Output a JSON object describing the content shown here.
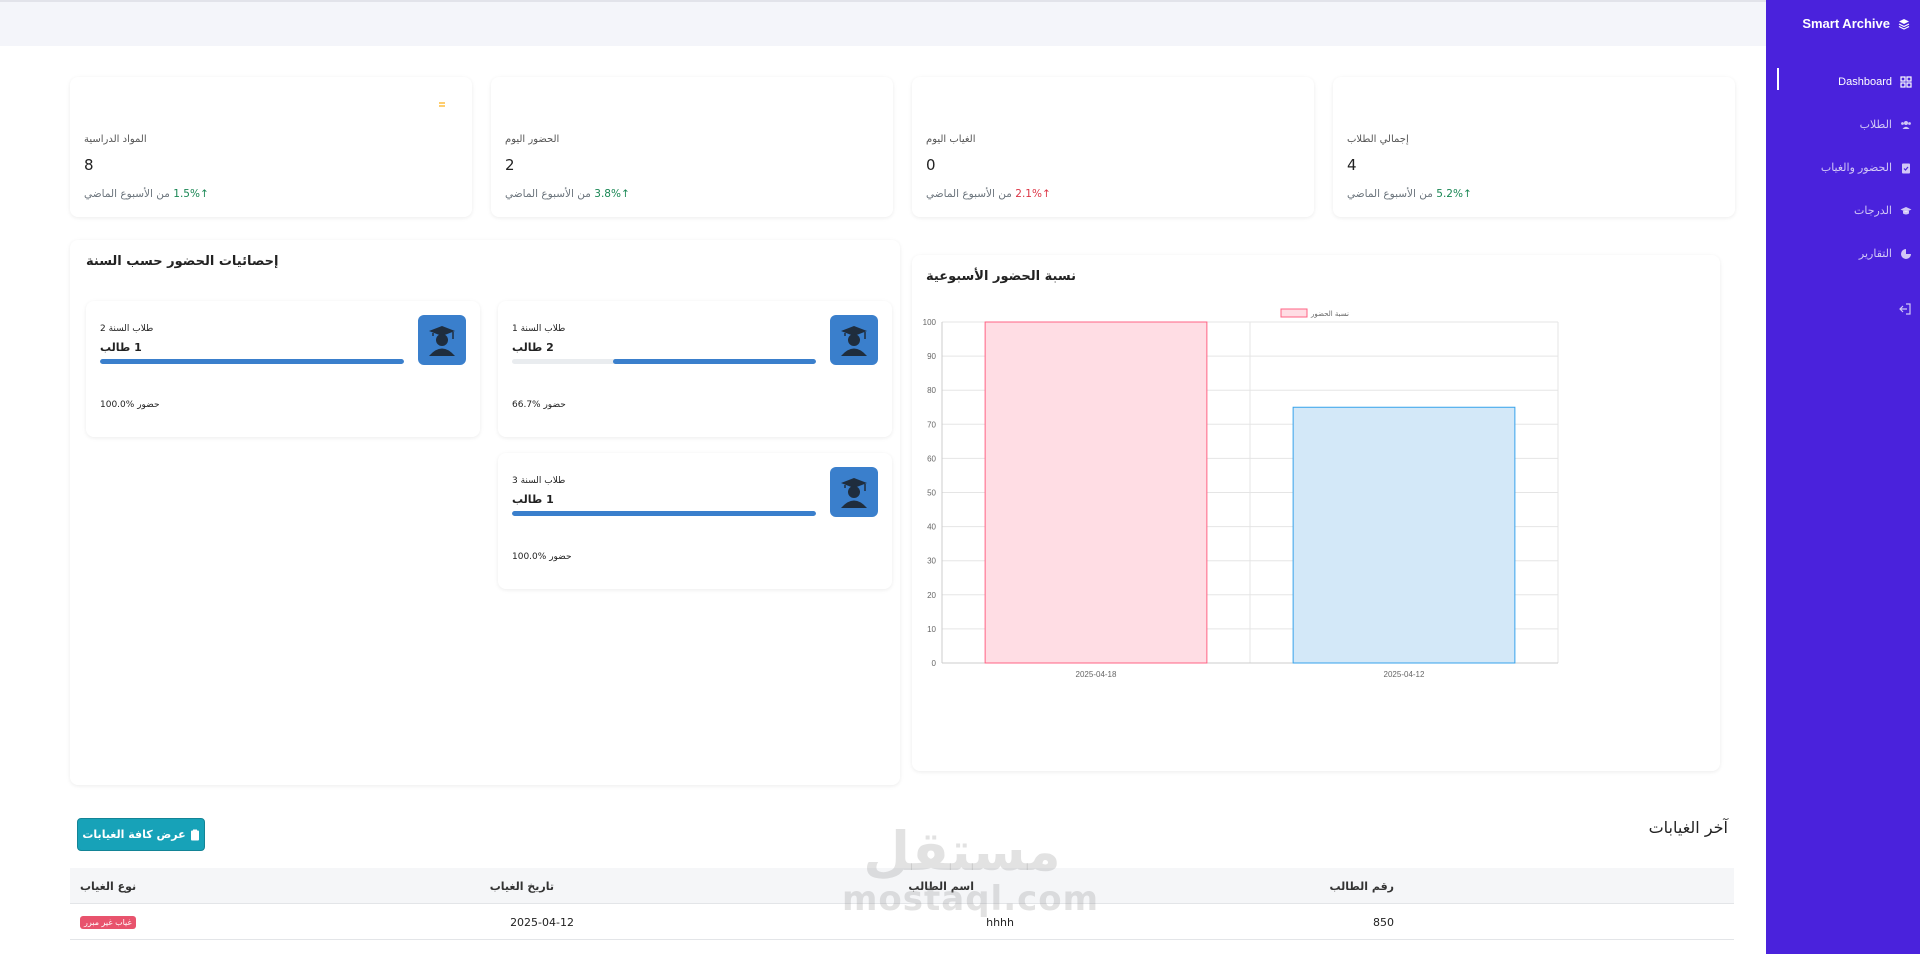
{
  "brand": {
    "name": "Smart Archive"
  },
  "sidebar": {
    "items": [
      {
        "label": "Dashboard",
        "icon": "grid-icon",
        "active": true
      },
      {
        "label": "الطلاب",
        "icon": "users-icon"
      },
      {
        "label": "الحضور والغياب",
        "icon": "clipboard-check-icon"
      },
      {
        "label": "الدرجات",
        "icon": "graduation-cap-icon"
      },
      {
        "label": "التقارير",
        "icon": "pie-chart-icon"
      }
    ],
    "logout_icon": "logout-icon",
    "bg_color": "#4a22dc"
  },
  "stats": [
    {
      "title": "المواد الدراسية",
      "value": "8",
      "change": "1.5%",
      "suffix": "من الأسبوع الماضي",
      "direction": "up",
      "icon": "book-icon",
      "color": "#fdb01b"
    },
    {
      "title": "الحضور اليوم",
      "value": "2",
      "change": "3.8%",
      "suffix": "من الأسبوع الماضي",
      "direction": "up",
      "icon": "user-check-icon",
      "color": "#1e9a3f"
    },
    {
      "title": "الغياب اليوم",
      "value": "0",
      "change": "2.1%",
      "suffix": "من الأسبوع الماضي",
      "direction": "up-red",
      "icon": "user-times-icon",
      "color": "#dc2b3b"
    },
    {
      "title": "إجمالي الطلاب",
      "value": "4",
      "change": "5.2%",
      "suffix": "من الأسبوع الماضي",
      "direction": "up",
      "icon": "users-icon",
      "color": "#3a86d0"
    }
  ],
  "year_stats": {
    "title": "إحصائيات الحضور حسب السنة",
    "years": [
      {
        "label": "طلاب السنة 1",
        "count": "2 طالب",
        "pct_text": "66.7% حضور",
        "fill": 0.667
      },
      {
        "label": "طلاب السنة 2",
        "count": "1 طالب",
        "pct_text": "100.0% حضور",
        "fill": 1.0
      },
      {
        "label": "طلاب السنة 3",
        "count": "1 طالب",
        "pct_text": "100.0% حضور",
        "fill": 1.0
      }
    ]
  },
  "chart_data": {
    "type": "bar",
    "title": "نسبة الحضور الأسبوعية",
    "categories": [
      "2025-04-18",
      "2025-04-12"
    ],
    "series": [
      {
        "name": "نسبة الحضور",
        "values": [
          100,
          75
        ]
      }
    ],
    "bar_fills": [
      "#ffdde4",
      "#d3e8f8"
    ],
    "bar_strokes": [
      "#ff6384",
      "#36a2eb"
    ],
    "ylim": [
      0,
      100
    ],
    "yticks": [
      0,
      10,
      20,
      30,
      40,
      50,
      60,
      70,
      80,
      90,
      100
    ],
    "grid": true,
    "legend": "top-center"
  },
  "absences": {
    "title": "آخر الغيابات",
    "button_label": "عرض كافة الغيابات",
    "headers": {
      "id": "رقم الطالب",
      "name": "اسم الطالب",
      "date": "تاريخ الغياب",
      "type": "نوع الغياب"
    },
    "rows": [
      {
        "id": "850",
        "name": "hhhh",
        "date": "2025-04-12",
        "type": "غياب غير مبرر"
      }
    ]
  },
  "watermark": {
    "line1": "مستقل",
    "line2": "mostaql.com"
  }
}
